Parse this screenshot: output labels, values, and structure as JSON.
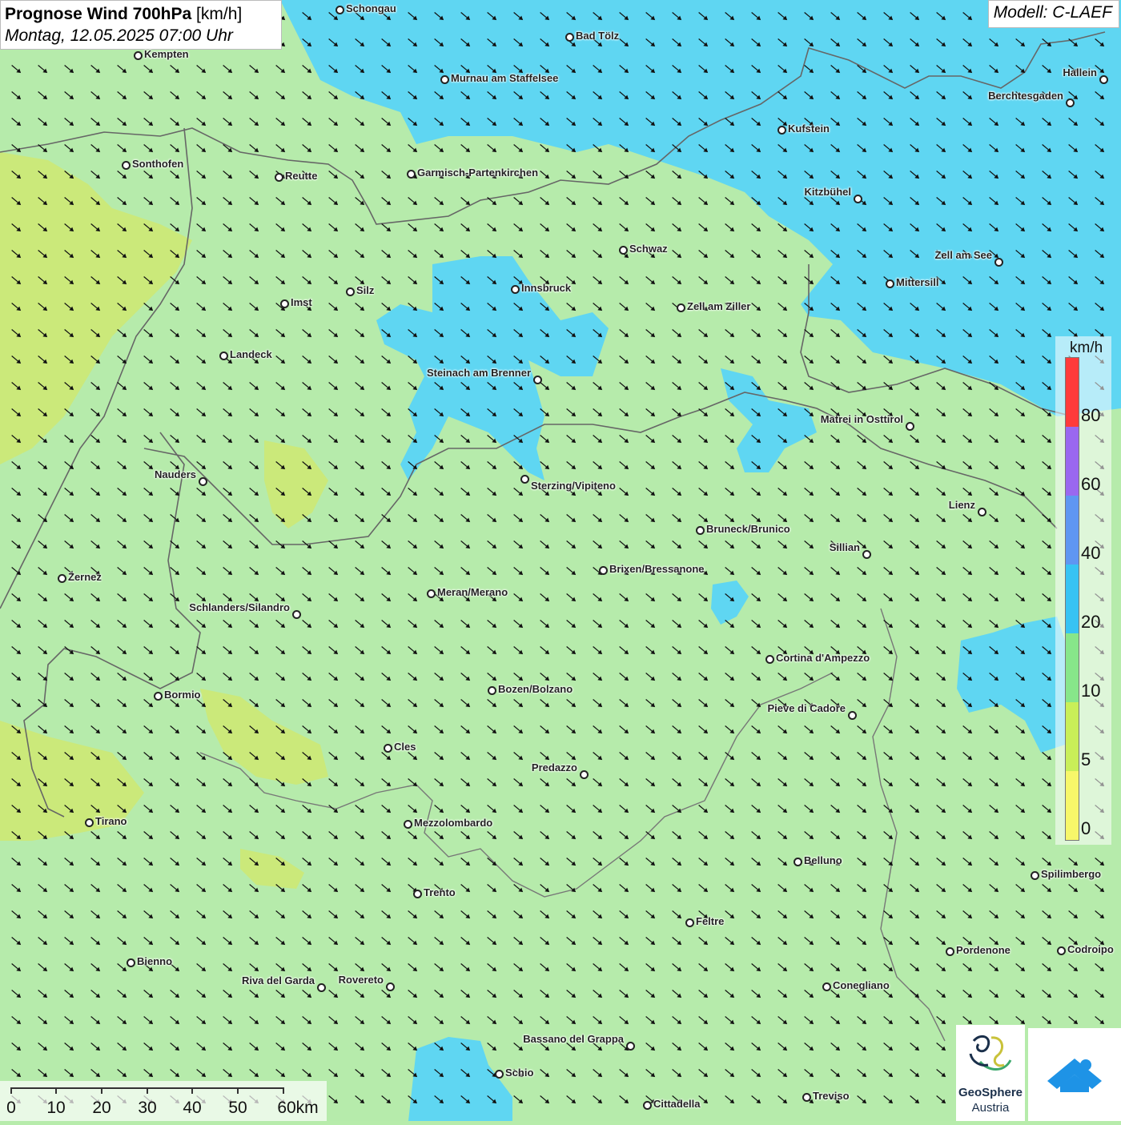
{
  "title": {
    "bold": "Prognose Wind 700hPa",
    "unit": "[km/h]",
    "date": "Montag, 12.05.2025 07:00 Uhr"
  },
  "model": "Modell: C-LAEF",
  "legend": {
    "unit": "km/h",
    "labels": [
      "80",
      "60",
      "40",
      "20",
      "10",
      "5",
      "0"
    ],
    "colors": [
      "#ff3b3b",
      "#9a68f0",
      "#5f96f2",
      "#37c3f3",
      "#87e68a",
      "#c9ef58",
      "#f7f76a"
    ]
  },
  "scale": {
    "labels": [
      "0",
      "10",
      "20",
      "30",
      "40",
      "50",
      "60km"
    ]
  },
  "logo": {
    "name": "GeoSphere",
    "sub": "Austria"
  },
  "cities": [
    {
      "name": "Schongau"
    },
    {
      "name": "Bad Tölz"
    },
    {
      "name": "Kempten"
    },
    {
      "name": "Murnau am Staffelsee"
    },
    {
      "name": "Hallein"
    },
    {
      "name": "Berchtesgaden"
    },
    {
      "name": "Kufstein"
    },
    {
      "name": "Sonthofen"
    },
    {
      "name": "Reutte"
    },
    {
      "name": "Garmisch-Partenkirchen"
    },
    {
      "name": "Kitzbühel"
    },
    {
      "name": "Schwaz"
    },
    {
      "name": "Zell am See"
    },
    {
      "name": "Mittersill"
    },
    {
      "name": "Innsbruck"
    },
    {
      "name": "Silz"
    },
    {
      "name": "Imst"
    },
    {
      "name": "Zell am Ziller"
    },
    {
      "name": "Landeck"
    },
    {
      "name": "Steinach am Brenner"
    },
    {
      "name": "Matrei in Osttirol"
    },
    {
      "name": "Nauders"
    },
    {
      "name": "Sterzing/Vipiteno"
    },
    {
      "name": "Lienz"
    },
    {
      "name": "Bruneck/Brunico"
    },
    {
      "name": "Sillian"
    },
    {
      "name": "Zernez"
    },
    {
      "name": "Brixen/Bressanone"
    },
    {
      "name": "Meran/Merano"
    },
    {
      "name": "Schlanders/Silandro"
    },
    {
      "name": "Cortina d'Ampezzo"
    },
    {
      "name": "Bozen/Bolzano"
    },
    {
      "name": "Bormio"
    },
    {
      "name": "Pieve di Cadore"
    },
    {
      "name": "Cles"
    },
    {
      "name": "Predazzo"
    },
    {
      "name": "Tirano"
    },
    {
      "name": "Mezzolombardo"
    },
    {
      "name": "Belluno"
    },
    {
      "name": "Spilimbergo"
    },
    {
      "name": "Trento"
    },
    {
      "name": "Feltre"
    },
    {
      "name": "Pordenone"
    },
    {
      "name": "Codroipo"
    },
    {
      "name": "Bienno"
    },
    {
      "name": "Riva del Garda"
    },
    {
      "name": "Rovereto"
    },
    {
      "name": "Conegliano"
    },
    {
      "name": "Bassano del Grappa"
    },
    {
      "name": "Schio"
    },
    {
      "name": "Treviso"
    },
    {
      "name": "Cittadella"
    }
  ]
}
